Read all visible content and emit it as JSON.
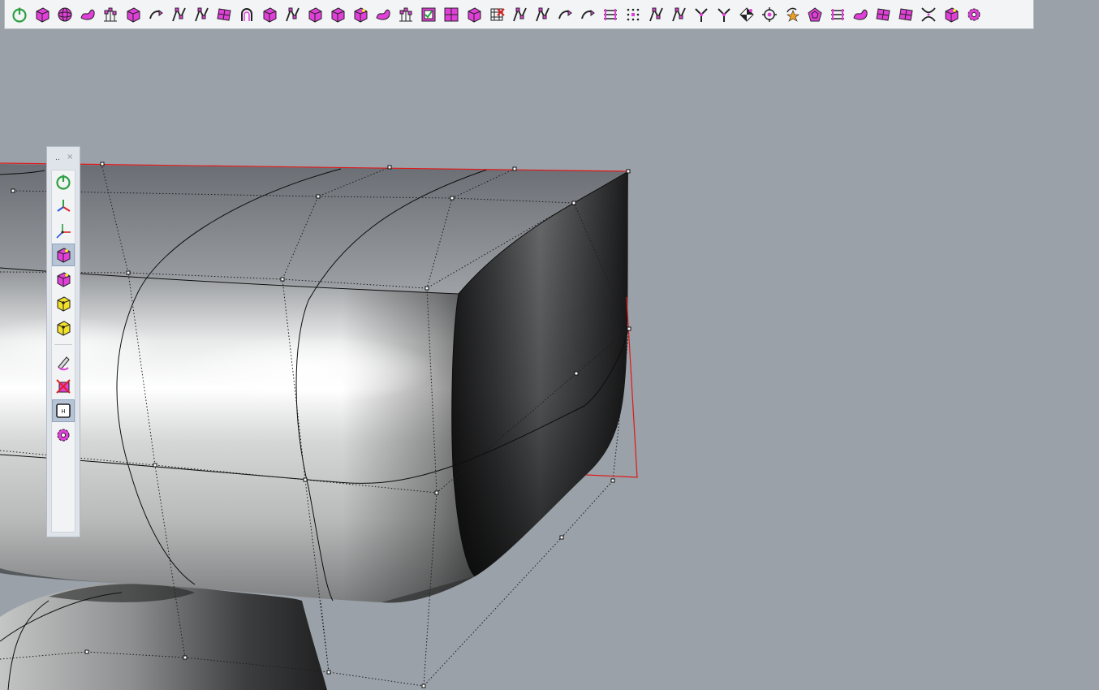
{
  "colors": {
    "viewport_background": "#9aa1a8",
    "toolbar_background": "#f3f4f6",
    "icon_magenta": "#e040d8",
    "icon_green": "#2ea043",
    "icon_yellow": "#f2e02a",
    "bounding_box_red": "#e01818",
    "active_button": "#b6c4d6"
  },
  "top_toolbar": {
    "icons": [
      "power-icon",
      "extract-solid-icon",
      "sphere-wire-icon",
      "blob-icon",
      "control-points-icon",
      "box-wire-icon",
      "curve-arrow-icon",
      "branch-icon",
      "rotate-points-icon",
      "surface-split-icon",
      "arch-icon",
      "fillet-edge-icon",
      "flag-icon",
      "insert-edge-icon",
      "insert-point-icon",
      "cube-face-icon",
      "soft-edge-icon",
      "points-ground-icon",
      "check-box-icon",
      "grid-box-icon",
      "stacked-boxes-icon",
      "delete-grid-icon",
      "mirror-figure-icon",
      "extrude-figure-icon",
      "bridge-icon",
      "swap-icon",
      "layers-icon",
      "dot-grid-icon",
      "curve-points-icon",
      "hand-select-icon",
      "split-arrows-icon",
      "pipe-y-icon",
      "diamond-icon",
      "target-icon",
      "rotate-star-icon",
      "pentagon-icon",
      "stairs-icon",
      "wave-surface-icon",
      "slanted-grid-icon",
      "diagonal-grid-icon",
      "pinch-icon",
      "shaded-cube-icon",
      "settings-gear-icon"
    ]
  },
  "side_toolbar": {
    "grip": "‥",
    "close": "×",
    "buttons": [
      {
        "icon": "power-icon",
        "active": false
      },
      {
        "icon": "gumball-axes-icon",
        "active": false
      },
      {
        "icon": "transform-axes-icon",
        "active": false
      },
      {
        "icon": "cube-vertex-icon",
        "active": true
      },
      {
        "icon": "cube-face-magenta-icon",
        "active": false
      },
      {
        "icon": "cube-edge-yellow-icon",
        "active": false
      },
      {
        "icon": "cube-vertex-yellow-icon",
        "active": false
      },
      {
        "icon": "edit-pencil-icon",
        "active": false
      },
      {
        "icon": "delete-tool-icon",
        "active": false
      },
      {
        "icon": "frame-h-icon",
        "active": true
      },
      {
        "icon": "settings-gear-icon",
        "active": false
      }
    ]
  }
}
